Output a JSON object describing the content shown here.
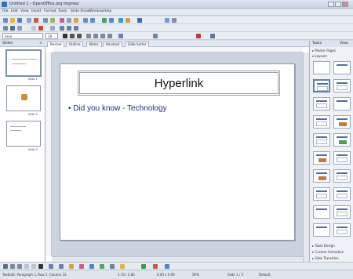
{
  "window": {
    "title": "Untitled 1 - OpenOffice.org Impress"
  },
  "menu": [
    "File",
    "Edit",
    "View",
    "Insert",
    "Format",
    "Tools",
    "Slide Show",
    "Window",
    "Help"
  ],
  "format_bar": {
    "font_name": "Arial",
    "font_size": "18"
  },
  "slides_pane": {
    "title": "Slides",
    "items": [
      {
        "label": "Slide 1"
      },
      {
        "label": "Slide 2"
      },
      {
        "label": "Slide 3"
      }
    ]
  },
  "view_tabs": [
    "Normal",
    "Outline",
    "Notes",
    "Handout",
    "Slide Sorter"
  ],
  "slide": {
    "title": "Hyperlink",
    "bullet": "Did you know - Technology"
  },
  "tasks": {
    "title": "Tasks",
    "view_label": "View",
    "sections": {
      "master": "Master Pages",
      "layouts": "Layouts",
      "table": "Table Design",
      "custom": "Custom Animation",
      "transition": "Slide Transition"
    }
  },
  "status": {
    "left": "TextEdit: Paragraph 1, Row 1, Column 32",
    "pos": "1.70 / 2.80",
    "size": "0.00 x 0.00",
    "zoom": "56%",
    "slide": "Slide 1 / 3",
    "layout": "Default"
  }
}
